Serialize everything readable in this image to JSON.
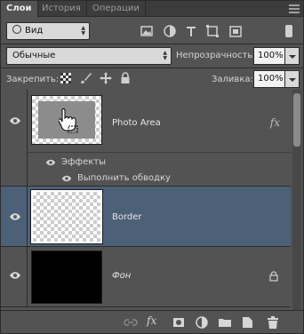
{
  "tabs": [
    {
      "label": "Слои",
      "active": true
    },
    {
      "label": "История",
      "active": false
    },
    {
      "label": "Операции",
      "active": false
    }
  ],
  "filter": {
    "label": "Вид"
  },
  "filter_icons": [
    "image-filter-icon",
    "adjustment-filter-icon",
    "type-filter-icon",
    "shape-filter-icon",
    "smart-object-filter-icon"
  ],
  "blend": {
    "value": "Обычные"
  },
  "opacity": {
    "label": "Непрозрачность:",
    "value": "100%"
  },
  "lock": {
    "label": "Закрепить:",
    "icons": [
      "lock-transparent-icon",
      "lock-image-icon",
      "lock-position-icon",
      "lock-all-icon"
    ]
  },
  "fill": {
    "label": "Заливка:",
    "value": "100%"
  },
  "layers": [
    {
      "name": "Photo Area",
      "fx": "fx",
      "effects_label": "Эффекты",
      "effect": "Выполнить обводку",
      "selected": false
    },
    {
      "name": "Border",
      "selected": true
    },
    {
      "name": "Фон",
      "locked": true,
      "selected": false
    }
  ],
  "bottom_icons": [
    "link-layers-icon",
    "fx-icon",
    "add-mask-icon",
    "adjustment-layer-icon",
    "new-group-icon",
    "new-layer-icon",
    "trash-icon"
  ],
  "colors": {
    "panel": "#535353",
    "selected": "#4c6078",
    "border": "#2b2b2b"
  }
}
